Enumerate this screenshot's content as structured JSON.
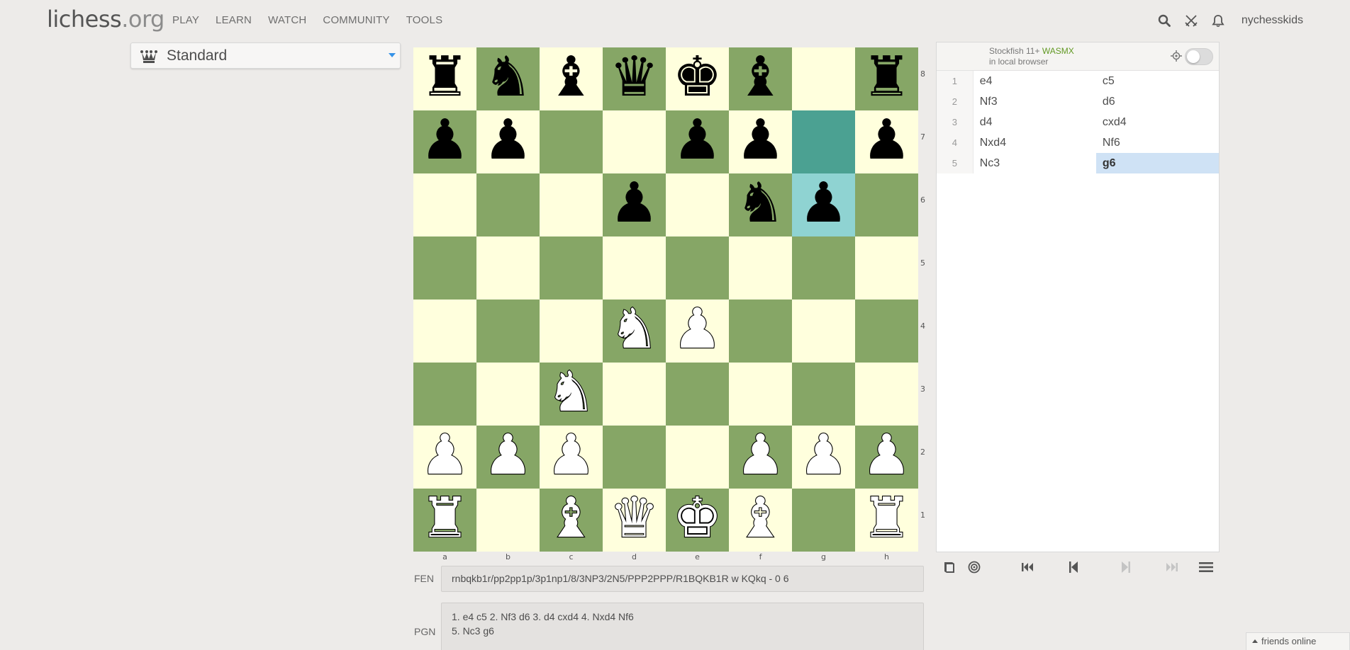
{
  "header": {
    "logo_main": "lichess",
    "logo_tld": ".org",
    "nav": [
      "PLAY",
      "LEARN",
      "WATCH",
      "COMMUNITY",
      "TOOLS"
    ],
    "username": "nychesskids",
    "icons": [
      "search-icon",
      "swords-icon",
      "bell-icon"
    ]
  },
  "variant": {
    "label": "Standard",
    "icon": "crown-icon"
  },
  "board": {
    "ranks": [
      "8",
      "7",
      "6",
      "5",
      "4",
      "3",
      "2",
      "1"
    ],
    "files": [
      "a",
      "b",
      "c",
      "d",
      "e",
      "f",
      "g",
      "h"
    ],
    "position": [
      [
        "br",
        "bn",
        "bb",
        "bq",
        "bk",
        "bb",
        "",
        ""
      ],
      [
        "bp",
        "bp",
        "",
        "",
        "bp",
        "bp",
        "",
        "bp"
      ],
      [
        "",
        "",
        "",
        "bp",
        "",
        "bn",
        "bp",
        ""
      ],
      [
        "",
        "",
        "",
        "",
        "",
        "",
        "",
        ""
      ],
      [
        "",
        "",
        "",
        "wn",
        "wp",
        "",
        "",
        ""
      ],
      [
        "",
        "",
        "wn",
        "",
        "",
        "",
        "",
        ""
      ],
      [
        "wp",
        "wp",
        "wp",
        "",
        "",
        "wp",
        "wp",
        "wp"
      ],
      [
        "wr",
        "",
        "wb",
        "wq",
        "wk",
        "wb",
        "",
        "wr"
      ]
    ],
    "rook_h8": "br",
    "last_move": {
      "from": "g7",
      "to": "g6"
    },
    "colors": {
      "light": "#ffffdd",
      "dark": "#86a666",
      "last_from": "#4ba192",
      "last_to": "#8fd3d2"
    }
  },
  "fen": {
    "label": "FEN",
    "value": "rnbqkb1r/pp2pp1p/3p1np1/8/3NP3/2N5/PPP2PPP/R1BQKB1R w KQkq - 0 6"
  },
  "pgn": {
    "label": "PGN",
    "line1": "1. e4 c5 2. Nf3 d6 3. d4 cxd4 4. Nxd4 Nf6",
    "line2": "5. Nc3 g6"
  },
  "ceval": {
    "engine": "Stockfish 11+",
    "tech": "WASMX",
    "location": "in local browser"
  },
  "moves": [
    {
      "n": "1",
      "white": "e4",
      "black": "c5"
    },
    {
      "n": "2",
      "white": "Nf3",
      "black": "d6"
    },
    {
      "n": "3",
      "white": "d4",
      "black": "cxd4"
    },
    {
      "n": "4",
      "white": "Nxd4",
      "black": "Nf6"
    },
    {
      "n": "5",
      "white": "Nc3",
      "black": "g6"
    }
  ],
  "active_move": "g6",
  "friends": {
    "label": "friends online"
  }
}
